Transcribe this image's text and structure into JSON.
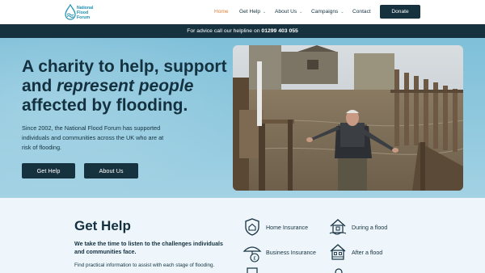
{
  "brand": {
    "name_line1": "National",
    "name_line2": "Flood",
    "name_line3": "Forum",
    "color": "#1e8fb0"
  },
  "nav": {
    "items": [
      {
        "label": "Home",
        "active": true
      },
      {
        "label": "Get Help",
        "dropdown": true
      },
      {
        "label": "About Us",
        "dropdown": true
      },
      {
        "label": "Campaigns",
        "dropdown": true
      },
      {
        "label": "Contact"
      }
    ],
    "donate_label": "Donate"
  },
  "helpline": {
    "prefix": "For advice call our helpline on",
    "number": "01299 403 055"
  },
  "hero": {
    "title_line1": "A charity to help, support",
    "title_line2_plain": "and ",
    "title_line2_em": "represent people",
    "title_line3": "affected by flooding.",
    "description": "Since 2002, the National Flood Forum has supported individuals and communities across the UK who are at risk of flooding.",
    "buttons": [
      "Get Help",
      "About Us"
    ]
  },
  "get_help": {
    "title": "Get Help",
    "subtitle": "We take the time to listen to the challenges individuals and communities face.",
    "info": "Find practical information to assist with each stage of flooding.",
    "services": [
      {
        "label": "Home Insurance",
        "icon": "shield-home-icon"
      },
      {
        "label": "During a flood",
        "icon": "flooded-house-icon"
      },
      {
        "label": "Business Insurance",
        "icon": "umbrella-money-icon"
      },
      {
        "label": "After a flood",
        "icon": "house-repair-icon"
      }
    ]
  },
  "colors": {
    "dark": "#16323f",
    "accent": "#e07f36",
    "hero_bg": "#8fc8de",
    "section_bg": "#eef6fb"
  }
}
